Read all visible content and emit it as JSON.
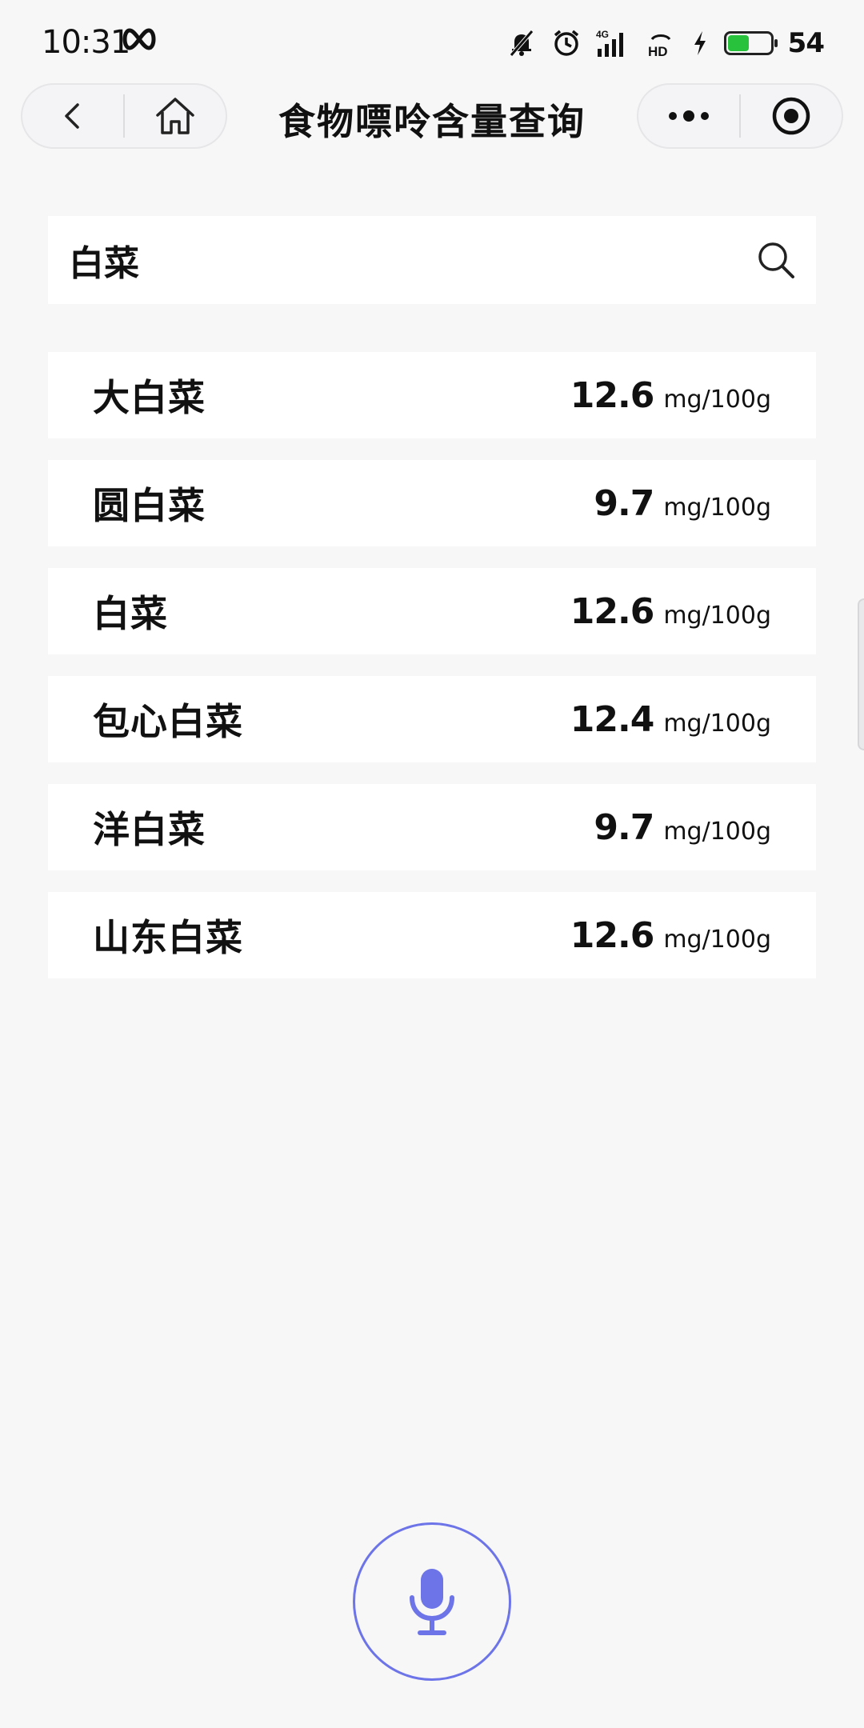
{
  "status_bar": {
    "time": "10:31",
    "battery_level": "54",
    "battery_fraction": 0.54,
    "battery_color": "#29c23c",
    "icons": [
      "infinity-icon",
      "mute-icon",
      "alarm-icon",
      "signal-4g-icon",
      "hd-icon",
      "charging-icon",
      "battery-icon"
    ]
  },
  "nav": {
    "title": "食物嘌呤含量查询",
    "left_icons": [
      "back-icon",
      "home-icon"
    ],
    "right_icons": [
      "more-icon",
      "record-icon"
    ]
  },
  "search": {
    "value": "白菜",
    "icon": "search-icon"
  },
  "results": [
    {
      "name": "大白菜",
      "value": "12.6",
      "unit": "mg/100g"
    },
    {
      "name": "圆白菜",
      "value": "9.7",
      "unit": "mg/100g"
    },
    {
      "name": "白菜",
      "value": "12.6",
      "unit": "mg/100g"
    },
    {
      "name": "包心白菜",
      "value": "12.4",
      "unit": "mg/100g"
    },
    {
      "name": "洋白菜",
      "value": "9.7",
      "unit": "mg/100g"
    },
    {
      "name": "山东白菜",
      "value": "12.6",
      "unit": "mg/100g"
    }
  ],
  "voice": {
    "icon": "microphone-icon",
    "accent_color": "#6c74e8"
  }
}
